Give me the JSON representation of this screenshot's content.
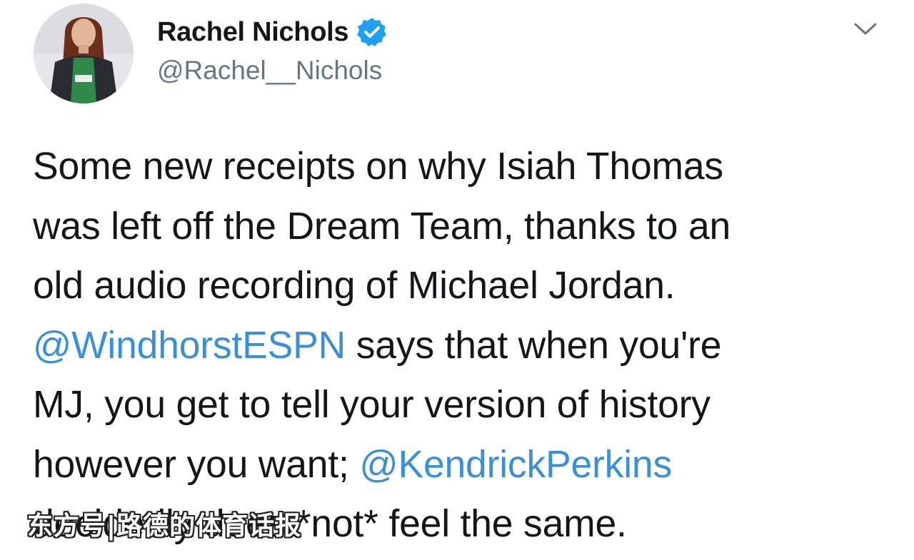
{
  "author": {
    "display_name": "Rachel Nichols",
    "handle": "@Rachel__Nichols",
    "verified": true,
    "avatar_icon": "profile-photo"
  },
  "menu": {
    "icon": "chevron-down-icon"
  },
  "tweet": {
    "lines": [
      [
        {
          "text": "Some new receipts on why Isiah Thomas",
          "mention": false
        }
      ],
      [
        {
          "text": "was left off the Dream Team, thanks to an",
          "mention": false
        }
      ],
      [
        {
          "text": "old audio recording of Michael Jordan.",
          "mention": false
        }
      ],
      [
        {
          "text": "@WindhorstESPN",
          "mention": true
        },
        {
          "text": " says that when you're",
          "mention": false
        }
      ],
      [
        {
          "text": "MJ, you get to tell your version of history",
          "mention": false
        }
      ],
      [
        {
          "text": "however you want; ",
          "mention": false
        },
        {
          "text": "@KendrickPerkins",
          "mention": true
        }
      ],
      [
        {
          "text": "decidedly does *not* feel the same.",
          "mention": false
        }
      ]
    ]
  },
  "watermark": {
    "text": "东方号|路德的体育话报"
  },
  "colors": {
    "mention": "#3a8fd6",
    "handle": "#657786",
    "verified": "#1da1f2",
    "text": "#14171a"
  }
}
